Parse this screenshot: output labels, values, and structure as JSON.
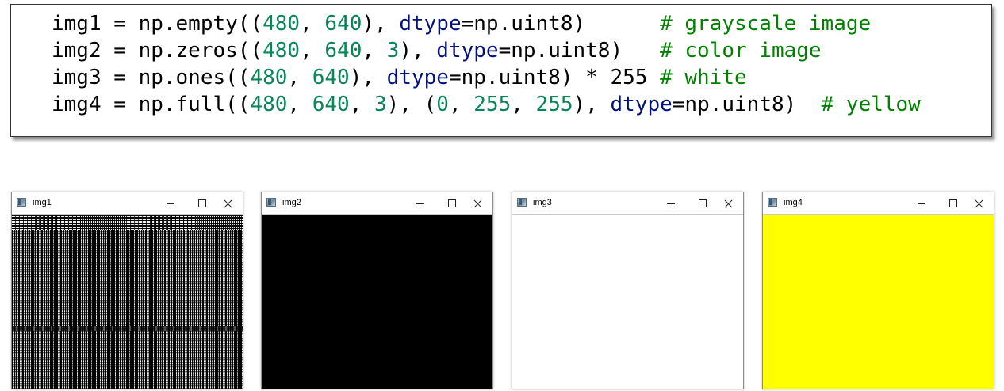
{
  "code": {
    "lines": [
      [
        {
          "t": "img1 = np.empty(("
        },
        {
          "t": "480",
          "c": "num"
        },
        {
          "t": ", "
        },
        {
          "t": "640",
          "c": "num"
        },
        {
          "t": "), "
        },
        {
          "t": "dtype",
          "c": "kw"
        },
        {
          "t": "=np.uint8)      "
        },
        {
          "t": "# grayscale image",
          "c": "cm"
        }
      ],
      [
        {
          "t": "img2 = np.zeros(("
        },
        {
          "t": "480",
          "c": "num"
        },
        {
          "t": ", "
        },
        {
          "t": "640",
          "c": "num"
        },
        {
          "t": ", "
        },
        {
          "t": "3",
          "c": "num"
        },
        {
          "t": "), "
        },
        {
          "t": "dtype",
          "c": "kw"
        },
        {
          "t": "=np.uint8)   "
        },
        {
          "t": "# color image",
          "c": "cm"
        }
      ],
      [
        {
          "t": "img3 = np.ones(("
        },
        {
          "t": "480",
          "c": "num"
        },
        {
          "t": ", "
        },
        {
          "t": "640",
          "c": "num"
        },
        {
          "t": "), "
        },
        {
          "t": "dtype",
          "c": "kw"
        },
        {
          "t": "=np.uint8) * 255 "
        },
        {
          "t": "# white",
          "c": "cm"
        }
      ],
      [
        {
          "t": "img4 = np.full(("
        },
        {
          "t": "480",
          "c": "num"
        },
        {
          "t": ", "
        },
        {
          "t": "640",
          "c": "num"
        },
        {
          "t": ", "
        },
        {
          "t": "3",
          "c": "num"
        },
        {
          "t": "), ("
        },
        {
          "t": "0",
          "c": "num"
        },
        {
          "t": ", "
        },
        {
          "t": "255",
          "c": "num"
        },
        {
          "t": ", "
        },
        {
          "t": "255",
          "c": "num"
        },
        {
          "t": "), "
        },
        {
          "t": "dtype",
          "c": "kw"
        },
        {
          "t": "=np.uint8)  "
        },
        {
          "t": "# yellow",
          "c": "cm"
        }
      ]
    ]
  },
  "windows": [
    {
      "title": "img1",
      "content": "noise",
      "icon": "opencv-window-icon",
      "minimize": "minimize-icon",
      "maximize": "maximize-icon",
      "close": "close-icon"
    },
    {
      "title": "img2",
      "content": "fill",
      "fill_color": "#000000"
    },
    {
      "title": "img3",
      "content": "fill",
      "fill_color": "#ffffff"
    },
    {
      "title": "img4",
      "content": "fill",
      "fill_color": "#ffff00"
    }
  ],
  "colors": {
    "number": "#098658",
    "keyword": "#001080",
    "comment": "#008000",
    "text": "#000000"
  }
}
